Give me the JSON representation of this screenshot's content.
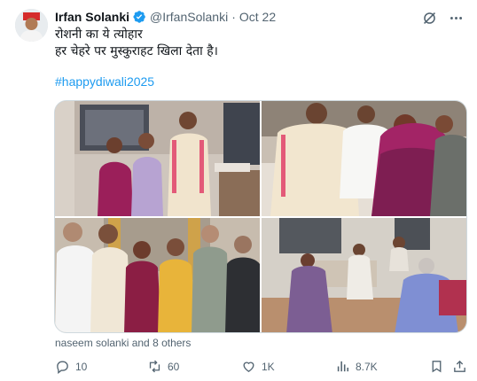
{
  "author": {
    "name": "Irfan Solanki",
    "handle": "@IrfanSolanki",
    "separator": "·",
    "date": "Oct 22",
    "verified_color": "#1d9bf0"
  },
  "tweet": {
    "line1": "रोशनी का ये त्योहार",
    "line2": "हर चेहरे पर मुस्कुराहट खिला देता है।",
    "hashtag": "#happydiwali2025"
  },
  "media": {
    "photos": [
      {
        "name": "photo-group-family-indoors"
      },
      {
        "name": "photo-seated-group"
      },
      {
        "name": "photo-standing-group"
      },
      {
        "name": "photo-living-room"
      }
    ]
  },
  "tagged": "naseem solanki and 8 others",
  "header_icons": [
    "grok-icon",
    "more-options-icon"
  ],
  "actions": {
    "replies": "10",
    "reposts": "60",
    "likes": "1K",
    "views": "8.7K"
  },
  "colors": {
    "accent": "#1d9bf0",
    "muted": "#536471",
    "text": "#0f1419"
  }
}
